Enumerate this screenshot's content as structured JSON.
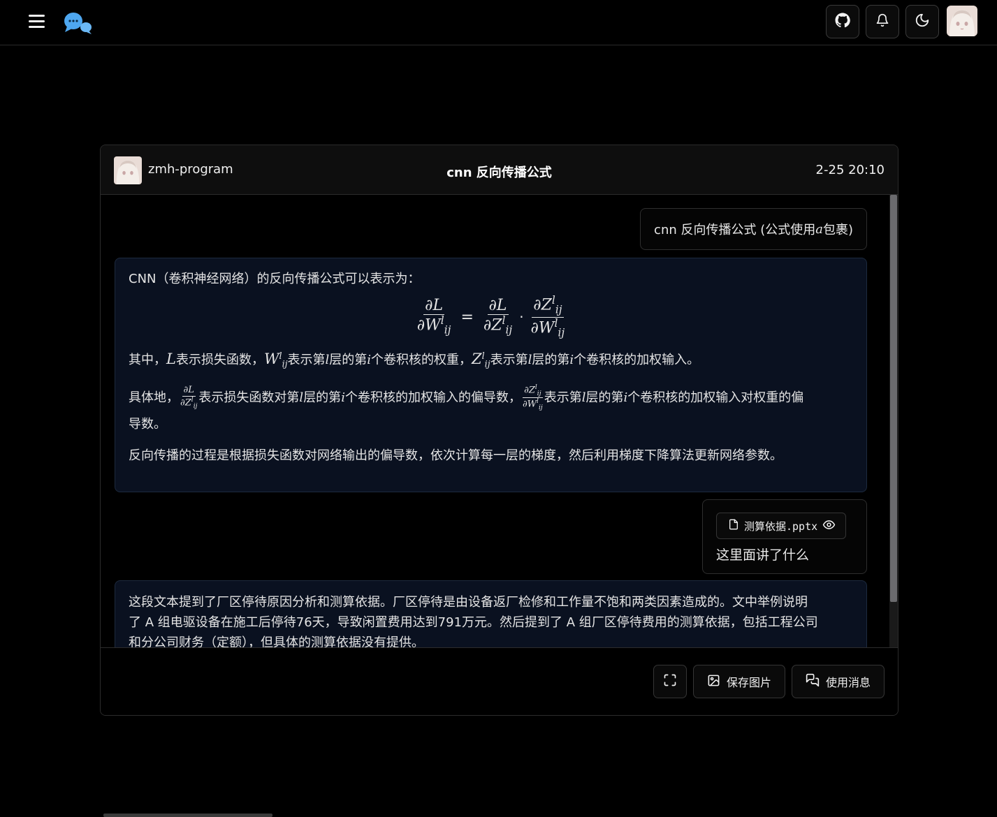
{
  "topbar": {
    "icons": [
      "menu-icon",
      "chat-bubbles-logo",
      "github-icon",
      "bell-icon",
      "moon-icon"
    ]
  },
  "header": {
    "username": "zmh-program",
    "title": "cnn 反向传播公式",
    "time": "2-25 20:10"
  },
  "messages": {
    "user1": {
      "text_prefix": "cnn 反向传播公式 (公式使用 ",
      "math_a": "a",
      "text_suffix": " 包裹)"
    },
    "bot1": {
      "intro": "CNN（卷积神经网络）的反向传播公式可以表示为：",
      "formula": {
        "lhs_num": "∂L",
        "lhs_den_base": "∂W",
        "rhs1_num": "∂L",
        "rhs1_den_base": "∂Z",
        "rhs2_num_base": "∂Z",
        "rhs2_den_base": "∂W",
        "sup": "l",
        "sub": "ij",
        "equals": "=",
        "dot": "·"
      },
      "line2": {
        "t1": "其中，",
        "L": "L",
        "t2": "表示损失函数，",
        "W": "W",
        "t3": "表示第",
        "l": "l",
        "t4": "层的第",
        "i": "i",
        "t5": "个卷积核的权重，",
        "Z": "Z",
        "t6": "表示第",
        "t7": "层的第",
        "t8": "个卷积核的加权输入。"
      },
      "line3": {
        "t1": "具体地，",
        "t2": "表示损失函数对第",
        "t3": "层的第",
        "t4": "个卷积核的加权输入的偏导数，",
        "t5": "表示第",
        "t6": "层的第",
        "t7": "个卷积核的加权输入对权重的偏",
        "t8": "导数。"
      },
      "line4": "反向传播的过程是根据损失函数对网络输出的偏导数，依次计算每一层的梯度，然后利用梯度下降算法更新网络参数。"
    },
    "user2": {
      "file_name": "测算依据.pptx",
      "text": "这里面讲了什么"
    },
    "bot2": {
      "line1": "这段文本提到了厂区停待原因分析和测算依据。厂区停待是由设备返厂检修和工作量不饱和两类因素造成的。文中举例说明",
      "line2": "了 A 组电驱设备在施工后停待76天，导致闲置费用达到791万元。然后提到了 A 组厂区停待费用的测算依据，包括工程公司",
      "line3": "和分公司财务（定额），但具体的测算依据没有提供。"
    }
  },
  "footer": {
    "fullscreen_icon": "expand-icon",
    "save_image_label": "保存图片",
    "use_message_label": "使用消息"
  }
}
